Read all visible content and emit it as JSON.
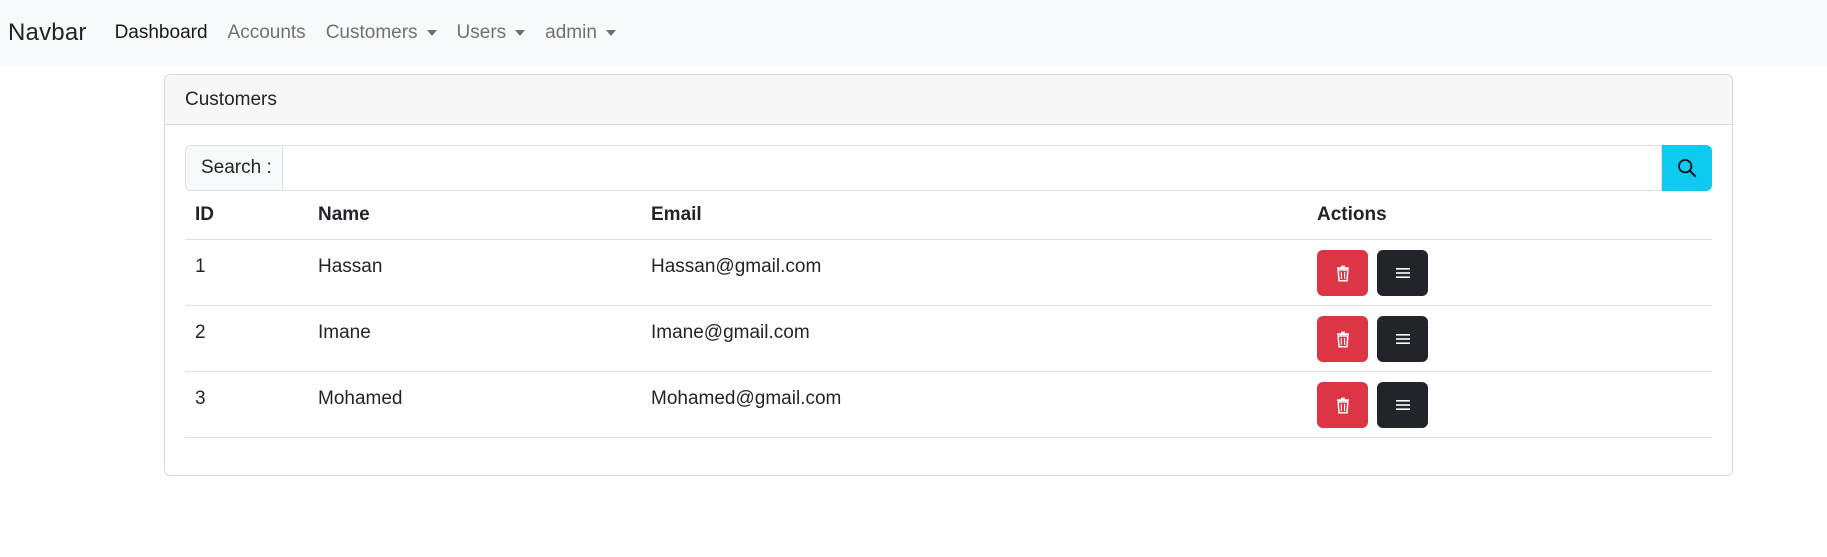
{
  "navbar": {
    "brand": "Navbar",
    "items": [
      {
        "label": "Dashboard",
        "dropdown": false
      },
      {
        "label": "Accounts",
        "dropdown": false
      },
      {
        "label": "Customers",
        "dropdown": true
      },
      {
        "label": "Users",
        "dropdown": true
      },
      {
        "label": "admin",
        "dropdown": true
      }
    ]
  },
  "card": {
    "title": "Customers",
    "search": {
      "label": "Search :",
      "value": "",
      "placeholder": "",
      "icon": "search-icon"
    },
    "table": {
      "columns": [
        "ID",
        "Name",
        "Email",
        "Actions"
      ],
      "rows": [
        {
          "id": "1",
          "name": "Hassan",
          "email": "Hassan@gmail.com"
        },
        {
          "id": "2",
          "name": "Imane",
          "email": "Imane@gmail.com"
        },
        {
          "id": "3",
          "name": "Mohamed",
          "email": "Mohamed@gmail.com"
        }
      ],
      "actions": [
        {
          "icon": "trash-icon",
          "color": "#dc3545"
        },
        {
          "icon": "menu-icon",
          "color": "#212529"
        }
      ]
    }
  },
  "colors": {
    "navbar_bg": "#f8f9fa",
    "search_button": "#0dcaf0",
    "danger": "#dc3545",
    "dark": "#212529"
  }
}
